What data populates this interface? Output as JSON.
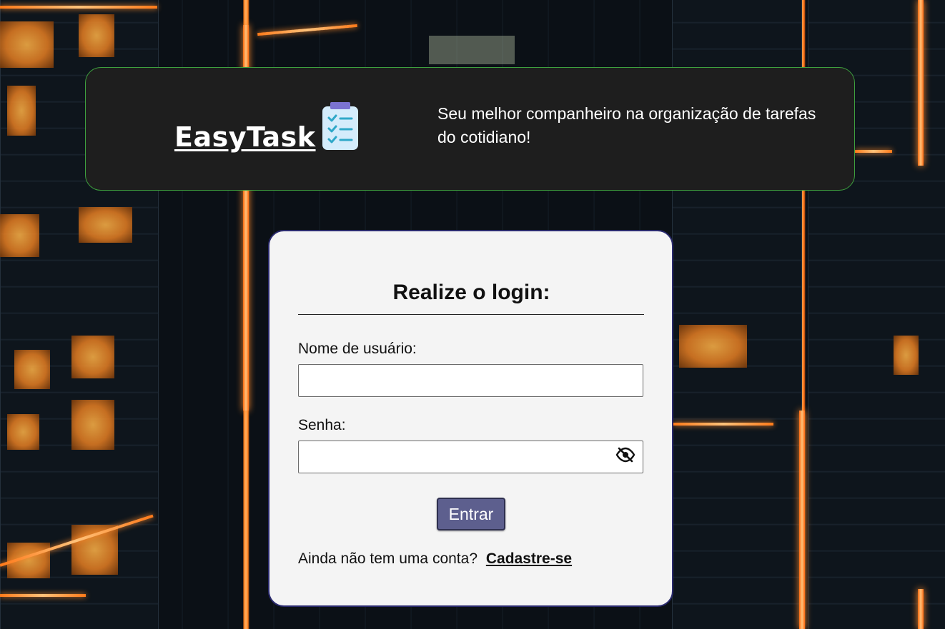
{
  "header": {
    "brand": "EasyTask",
    "brand_icon": "clipboard-checklist-icon",
    "tagline": "Seu melhor companheiro na organização de tarefas do cotidiano!",
    "border_color": "#3ea03e",
    "background": "#1e1e1e"
  },
  "login": {
    "title": "Realize o login:",
    "username_label": "Nome de usuário:",
    "username_value": "",
    "password_label": "Senha:",
    "password_value": "",
    "password_toggle_icon": "eye-slash-icon",
    "submit_label": "Entrar",
    "signup_prompt": "Ainda não tem uma conta?",
    "signup_link": "Cadastre-se",
    "button_color": "#5d5f8e",
    "border_color": "#2a2a6e"
  }
}
